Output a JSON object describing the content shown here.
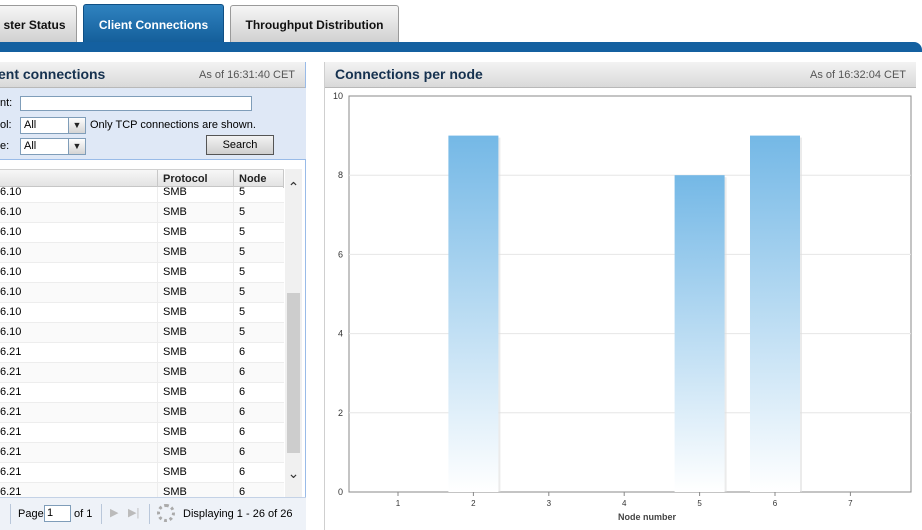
{
  "tabs": [
    {
      "label": "ster Status",
      "active": false
    },
    {
      "label": "Client Connections",
      "active": true
    },
    {
      "label": "Throughput Distribution",
      "active": false
    }
  ],
  "left_panel": {
    "title": "ent connections",
    "timestamp": "As of 16:31:40 CET",
    "filters": {
      "client_label": "nt:",
      "client_value": "",
      "protocol_label": "ol:",
      "protocol_value": "All",
      "protocol_note": "Only TCP connections are shown.",
      "node_label": "e:",
      "node_value": "All",
      "search_label": "Search"
    },
    "columns": [
      "Protocol",
      "Node"
    ],
    "rows": [
      {
        "client": "6.10",
        "protocol": "SMB",
        "node": "5"
      },
      {
        "client": "6.10",
        "protocol": "SMB",
        "node": "5"
      },
      {
        "client": "6.10",
        "protocol": "SMB",
        "node": "5"
      },
      {
        "client": "6.10",
        "protocol": "SMB",
        "node": "5"
      },
      {
        "client": "6.10",
        "protocol": "SMB",
        "node": "5"
      },
      {
        "client": "6.10",
        "protocol": "SMB",
        "node": "5"
      },
      {
        "client": "6.10",
        "protocol": "SMB",
        "node": "5"
      },
      {
        "client": "6.10",
        "protocol": "SMB",
        "node": "5"
      },
      {
        "client": "6.21",
        "protocol": "SMB",
        "node": "6"
      },
      {
        "client": "6.21",
        "protocol": "SMB",
        "node": "6"
      },
      {
        "client": "6.21",
        "protocol": "SMB",
        "node": "6"
      },
      {
        "client": "6.21",
        "protocol": "SMB",
        "node": "6"
      },
      {
        "client": "6.21",
        "protocol": "SMB",
        "node": "6"
      },
      {
        "client": "6.21",
        "protocol": "SMB",
        "node": "6"
      },
      {
        "client": "6.21",
        "protocol": "SMB",
        "node": "6"
      },
      {
        "client": "6.21",
        "protocol": "SMB",
        "node": "6"
      }
    ],
    "pager": {
      "page_label": "Page",
      "page_value": "1",
      "of_label": "of 1",
      "display_text": "Displaying 1 - 26 of 26"
    }
  },
  "right_panel": {
    "title": "Connections per node",
    "timestamp": "As of 16:32:04 CET"
  },
  "chart_data": {
    "type": "bar",
    "categories": [
      "1",
      "2",
      "3",
      "4",
      "5",
      "6",
      "7"
    ],
    "values": [
      0,
      9,
      0,
      0,
      8,
      9,
      0
    ],
    "xlabel": "Node number",
    "ylabel": "",
    "ylim": [
      0,
      10
    ],
    "yticks": [
      0,
      2,
      4,
      6,
      8,
      10
    ],
    "grid": true,
    "bar_color": "#74b8e6"
  }
}
